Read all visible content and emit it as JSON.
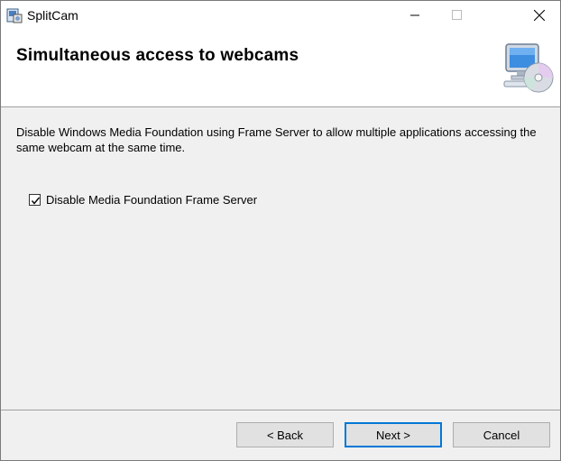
{
  "window": {
    "title": "SplitCam"
  },
  "header": {
    "title": "Simultaneous access to webcams"
  },
  "body": {
    "description": "Disable Windows Media Foundation using Frame Server to allow multiple applications accessing the same webcam at the same time.",
    "checkbox": {
      "label": "Disable Media Foundation Frame Server",
      "checked": true
    }
  },
  "buttons": {
    "back": "< Back",
    "next": "Next >",
    "cancel": "Cancel"
  },
  "icons": {
    "app": "splitcam-installer-icon",
    "header": "computer-cd-icon"
  }
}
